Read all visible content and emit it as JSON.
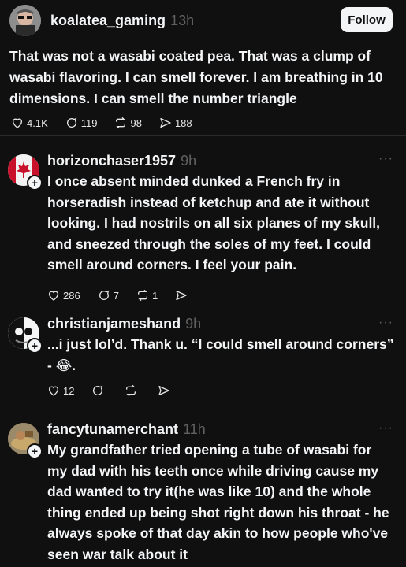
{
  "main_post": {
    "username": "koalatea_gaming",
    "time": "13h",
    "follow_label": "Follow",
    "text": "That was not a wasabi coated pea. That was a clump of wasabi flavoring. I can smell forever. I am breathing in 10 dimensions. I can smell the number triangle",
    "likes": "4.1K",
    "replies": "119",
    "reposts": "98",
    "shares": "188"
  },
  "replies": [
    {
      "username": "horizonchaser1957",
      "time": "9h",
      "text": "I once absent minded dunked a French fry in horseradish instead of ketchup and ate it without looking. I had nostrils on all six planes of my skull, and sneezed through the soles of my feet. I could smell around corners. I feel your pain.",
      "likes": "286",
      "replies": "7",
      "reposts": "1"
    },
    {
      "username": "christianjameshand",
      "time": "9h",
      "text": "...i just lol’d. Thank u. “I could smell around corners” - 😂.",
      "likes": "12"
    },
    {
      "username": "fancytunamerchant",
      "time": "11h",
      "text": "My grandfather tried opening a tube of wasabi for my dad with his teeth once while driving cause my dad wanted to try it(he was like 10) and the whole thing ended up being shot right down his throat - he always spoke of that day akin to how people who've seen war talk about it"
    }
  ],
  "icons": {
    "like": "heart-icon",
    "reply": "comment-icon",
    "repost": "repost-icon",
    "share": "share-icon",
    "more": "more-icon",
    "follow_plus": "plus-icon"
  },
  "colors": {
    "background": "#101010",
    "text": "#f3f5f7",
    "muted": "#616161",
    "divider": "#2a2a2a"
  }
}
